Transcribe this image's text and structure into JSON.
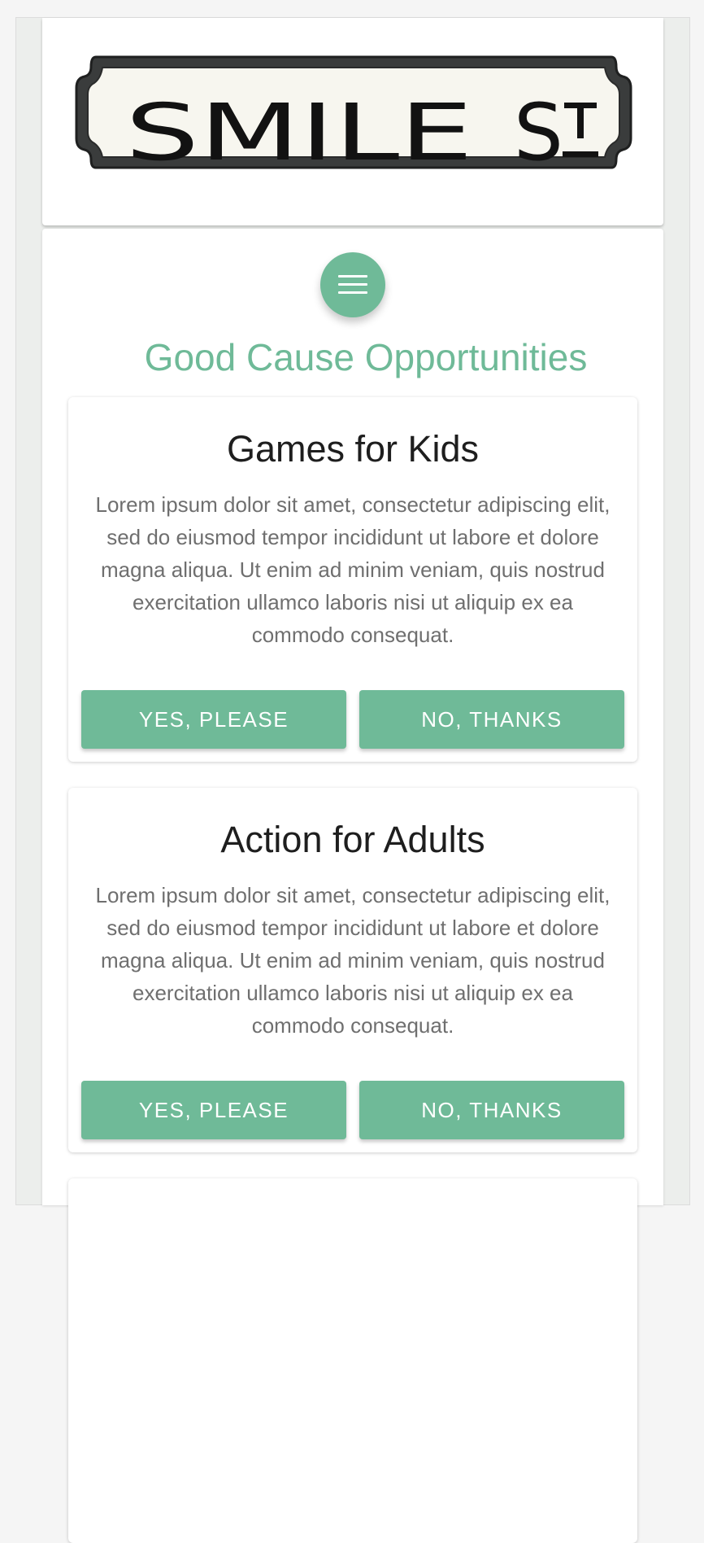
{
  "logo": {
    "text": "SMILE St",
    "alt": "Smile St street sign logo"
  },
  "menu": {
    "icon": "hamburger-menu-icon"
  },
  "page": {
    "title": "Good Cause Opportunities"
  },
  "opportunities": [
    {
      "title": "Games for Kids",
      "description": "Lorem ipsum dolor sit amet, consectetur adipiscing elit, sed do eiusmod tempor incididunt ut labore et dolore magna aliqua. Ut enim ad minim veniam, quis nostrud exercitation ullamco laboris nisi ut aliquip ex ea commodo consequat.",
      "accept_label": "YES, PLEASE",
      "decline_label": "NO, THANKS"
    },
    {
      "title": "Action for Adults",
      "description": "Lorem ipsum dolor sit amet, consectetur adipiscing elit, sed do eiusmod tempor incididunt ut labore et dolore magna aliqua. Ut enim ad minim veniam, quis nostrud exercitation ullamco laboris nisi ut aliquip ex ea commodo consequat.",
      "accept_label": "YES, PLEASE",
      "decline_label": "NO, THANKS"
    }
  ],
  "colors": {
    "accent": "#6fba98",
    "background": "#eceeec",
    "card": "#ffffff",
    "title_text": "#1e1e1e",
    "body_text": "#6f6f6f"
  }
}
